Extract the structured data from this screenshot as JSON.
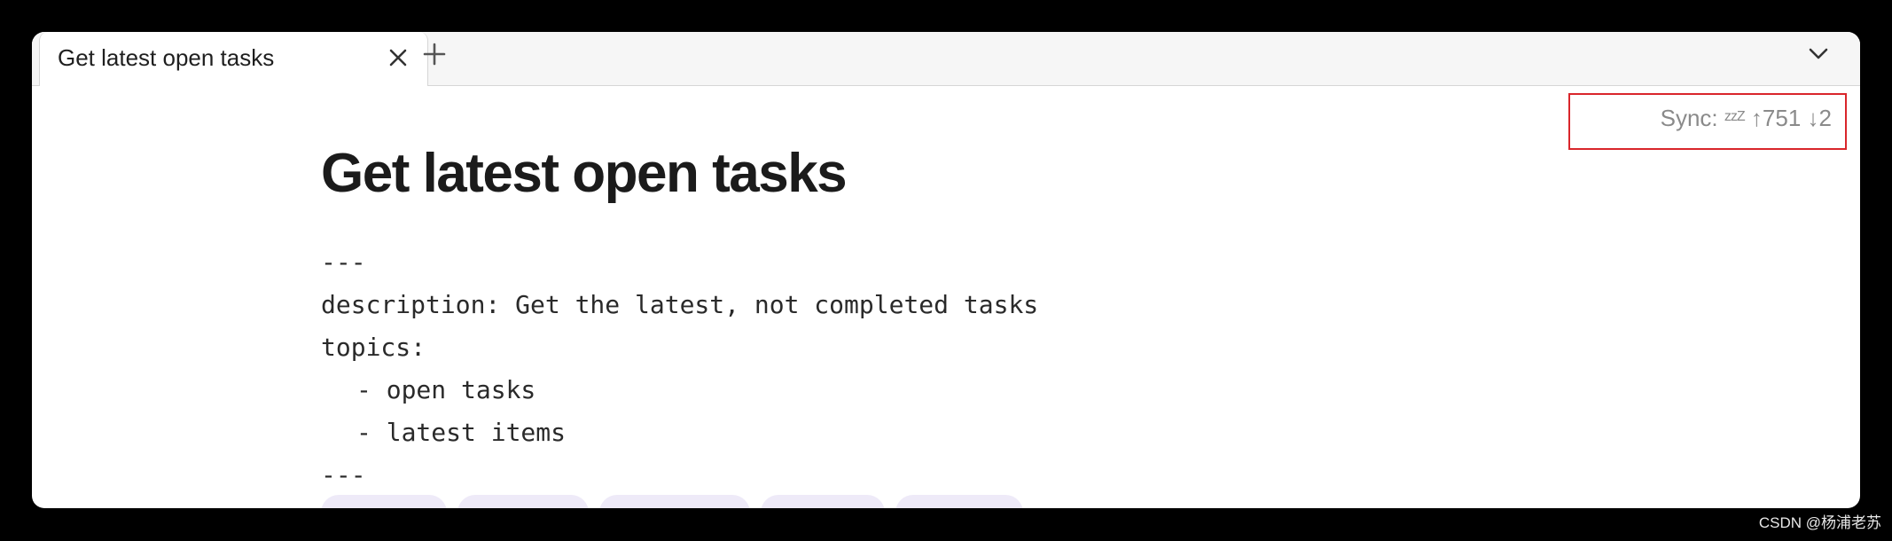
{
  "tabs": [
    {
      "title": "Get latest open tasks"
    }
  ],
  "icons": {
    "close": "close-icon",
    "new_tab": "plus-icon",
    "tab_list": "chevron-down-icon"
  },
  "sync": {
    "label": "Sync:",
    "sleep_glyph": "zzZ",
    "uploads": "↑751",
    "downloads": "↓2"
  },
  "note": {
    "title": "Get latest open tasks",
    "frontmatter": {
      "open_delimiter": "---",
      "description_line": "description: Get the latest, not completed tasks",
      "topics_line": "topics:",
      "topic_items": [
        "- open tasks",
        "- latest items"
      ],
      "close_delimiter": "---"
    },
    "tag_count": 5
  },
  "colors": {
    "highlight_box": "#d9262b",
    "tag_background": "#eeeaf8"
  },
  "watermark": "CSDN @杨浦老苏"
}
